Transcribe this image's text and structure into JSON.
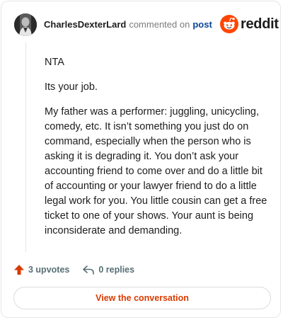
{
  "header": {
    "username": "CharlesDexterLard",
    "action_text": "commented on",
    "post_link": "post",
    "brand_name": "reddit",
    "brand_color": "#ff4500"
  },
  "comment": {
    "paragraphs": [
      "NTA",
      "Its your job.",
      "My father was a performer: juggling, unicycling, comedy, etc. It isn’t something you just do on command, especially when the person who is asking it is degrading it. You don’t ask your accounting friend to come over and do a little bit of accounting or your lawyer friend to do a little legal work for you. You little cousin can get a free ticket to one of your shows. Your aunt is being inconsiderate and demanding."
    ]
  },
  "actions": {
    "upvotes_label": "3 upvotes",
    "replies_label": "0 replies",
    "upvote_icon": "upvote-arrow-icon",
    "reply_icon": "reply-arrow-icon",
    "upvote_color": "#d93a00"
  },
  "cta": {
    "label": "View the conversation",
    "color": "#d93a00"
  }
}
